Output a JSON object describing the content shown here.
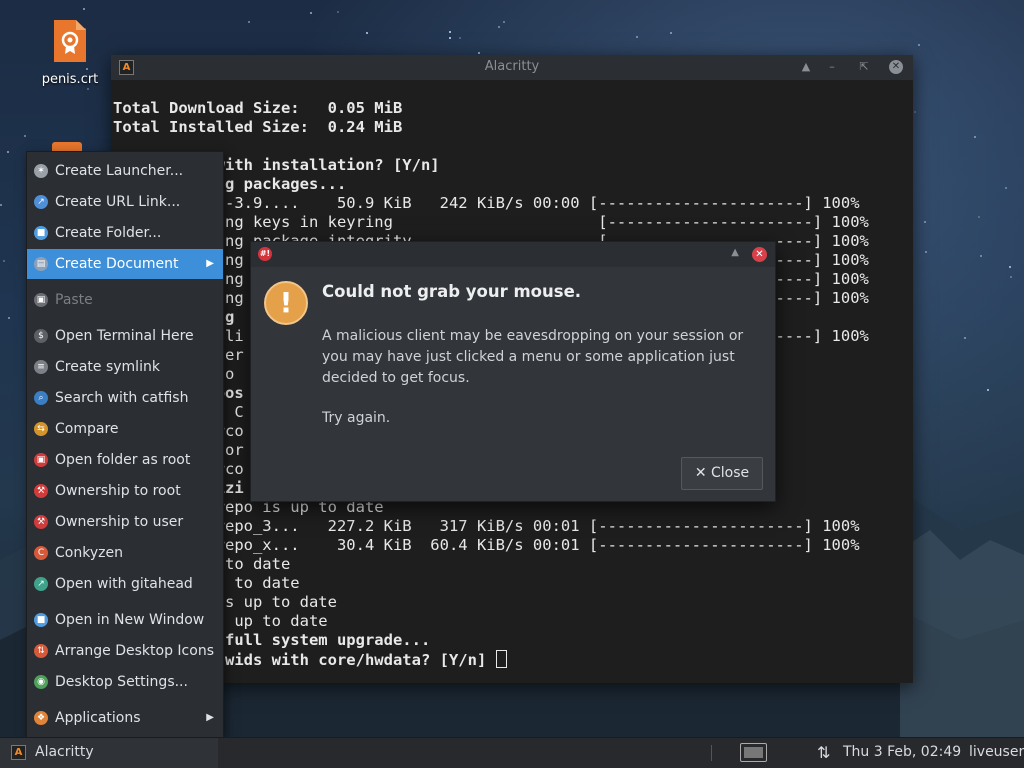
{
  "desktop": {
    "icon_label": "penis.crt"
  },
  "terminal": {
    "title": "Alacritty",
    "lines": [
      {
        "text": "Total Download Size:   0.05 MiB",
        "bold": true
      },
      {
        "text": "Total Installed Size:  0.24 MiB",
        "bold": true
      },
      {
        "text": "",
        "bold": false
      },
      {
        "text": "           with installation? [Y/n]",
        "bold": true
      },
      {
        "text": "           ng packages...",
        "bold": true
      },
      {
        "text": "           h-3.9....    50.9 KiB   242 KiB/s 00:00 [----------------------] 100%",
        "bold": false
      },
      {
        "text": "           ing keys in keyring                      [----------------------] 100%",
        "bold": false
      },
      {
        "text": "           ing package integrity                    [----------------------] 100%",
        "bold": false
      },
      {
        "text": "           ing package files                        [----------------------] 100%",
        "bold": false
      },
      {
        "text": "           ing                                      [----------------------] 100%",
        "bold": false
      },
      {
        "text": "           ing                                      [----------------------] 100%",
        "bold": false
      },
      {
        "text": "           ng",
        "bold": true
      },
      {
        "text": "           lli                                      [----------------------] 100%",
        "bold": false
      },
      {
        "text": "           per",
        "bold": false
      },
      {
        "text": "           to",
        "bold": false
      },
      {
        "text": "           pos",
        "bold": true
      },
      {
        "text": "           g C",
        "bold": false
      },
      {
        "text": "           rco",
        "bold": false
      },
      {
        "text": "            or",
        "bold": false
      },
      {
        "text": "           rco",
        "bold": false
      },
      {
        "text": "           izi",
        "bold": true
      },
      {
        "text": "           repo is up to date",
        "bold": false
      },
      {
        "text": "           repo_3...   227.2 KiB   317 KiB/s 00:01 [----------------------] 100%",
        "bold": false
      },
      {
        "text": "           repo_x...    30.4 KiB  60.4 KiB/s 00:01 [----------------------] 100%",
        "bold": false
      },
      {
        "text": "            to date",
        "bold": false
      },
      {
        "text": "           p to date",
        "bold": false
      },
      {
        "text": "           is up to date",
        "bold": false
      },
      {
        "text": "           s up to date",
        "bold": false
      },
      {
        "text": "            full system upgrade...",
        "bold": true
      },
      {
        "text": "           hwids with core/hwdata? [Y/n] ",
        "bold": true
      }
    ]
  },
  "context_menu": {
    "items": [
      {
        "label": "Create Launcher...",
        "icon": "gear-icon",
        "color": "#9aa0a8",
        "glyph": "✶"
      },
      {
        "label": "Create URL Link...",
        "icon": "link-icon",
        "color": "#4f8fd8",
        "glyph": "↗"
      },
      {
        "label": "Create Folder...",
        "icon": "folder-icon",
        "color": "#4f9de0",
        "glyph": "■"
      },
      {
        "label": "Create Document",
        "icon": "document-icon",
        "color": "#8ea0b8",
        "glyph": "▤",
        "submenu": true,
        "active": true
      },
      {
        "label": "Paste",
        "icon": "paste-icon",
        "color": "#6b6f75",
        "glyph": "▣",
        "disabled": true
      },
      {
        "label": "Open Terminal Here",
        "icon": "terminal-icon",
        "color": "#5d6166",
        "glyph": "$"
      },
      {
        "label": "Create symlink",
        "icon": "symlink-icon",
        "color": "#7d8187",
        "glyph": "≡"
      },
      {
        "label": "Search with catfish",
        "icon": "catfish-icon",
        "color": "#3a7ec4",
        "glyph": "⌕"
      },
      {
        "label": "Compare",
        "icon": "compare-icon",
        "color": "#d4942c",
        "glyph": "⇆"
      },
      {
        "label": "Open folder as root",
        "icon": "root-folder-icon",
        "color": "#d03c3c",
        "glyph": "▣"
      },
      {
        "label": "Ownership to root",
        "icon": "tools-icon",
        "color": "#d03c3c",
        "glyph": "⚒"
      },
      {
        "label": "Ownership to user",
        "icon": "tools-icon",
        "color": "#d03c3c",
        "glyph": "⚒"
      },
      {
        "label": "Conkyzen",
        "icon": "conky-icon",
        "color": "#d65a3a",
        "glyph": "C"
      },
      {
        "label": "Open with gitahead",
        "icon": "gitahead-icon",
        "color": "#3fa28a",
        "glyph": "↗"
      },
      {
        "label": "Open in New Window",
        "icon": "folder-icon",
        "color": "#4f9de0",
        "glyph": "■"
      },
      {
        "label": "Arrange Desktop Icons",
        "icon": "sort-icon",
        "color": "#d65a3a",
        "glyph": "⇅"
      },
      {
        "label": "Desktop Settings...",
        "icon": "desktop-settings-icon",
        "color": "#4fa05a",
        "glyph": "◉"
      },
      {
        "label": "Applications",
        "icon": "applications-icon",
        "color": "#e0843a",
        "glyph": "❖",
        "submenu": true
      }
    ]
  },
  "dialog": {
    "heading": "Could not grab your mouse.",
    "message": "A malicious client may be eavesdropping on your session or you may have just clicked a menu or some application just decided to get focus.",
    "retry_text": "Try again.",
    "close_label": "Close",
    "app_icon_text": "#!"
  },
  "taskbar": {
    "app_label": "Alacritty",
    "clock": "Thu  3 Feb, 02:49",
    "user": "liveuser"
  }
}
